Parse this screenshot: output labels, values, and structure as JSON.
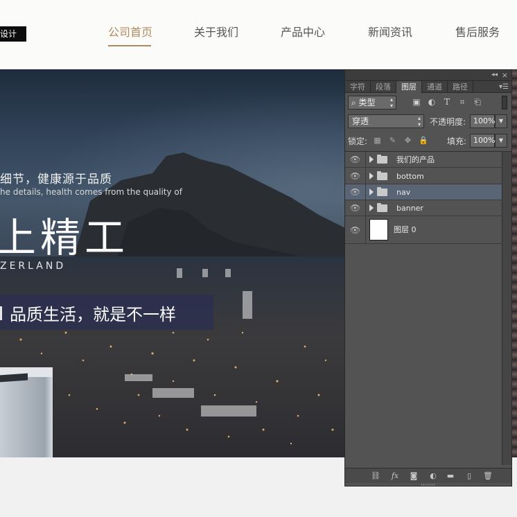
{
  "header": {
    "logo_text": "设计",
    "nav": [
      {
        "label": "公司首页",
        "active": true
      },
      {
        "label": "关于我们"
      },
      {
        "label": "产品中心"
      },
      {
        "label": "新闻资讯"
      },
      {
        "label": "售后服务"
      }
    ],
    "accent_color": "#b08a5c"
  },
  "banner": {
    "line1": "细节，健康源于品质",
    "line2": "he details, health comes from the quality of",
    "big_title": "上精工",
    "english": "ZERLAND",
    "slogan": "品质生活，就是不一样"
  },
  "ps_panel": {
    "tabs": [
      {
        "label": "字符"
      },
      {
        "label": "段落"
      },
      {
        "label": "图层",
        "active": true
      },
      {
        "label": "通道"
      },
      {
        "label": "路径"
      }
    ],
    "filter": {
      "label": "类型",
      "icons": [
        "image-filter-icon",
        "adjustment-filter-icon",
        "type-filter-icon",
        "shape-filter-icon",
        "smart-object-filter-icon"
      ]
    },
    "blend_mode": "穿透",
    "opacity_label": "不透明度:",
    "opacity_value": "100%",
    "lock_label": "锁定:",
    "fill_label": "填充:",
    "fill_value": "100%",
    "layers": [
      {
        "name": "我们的产品",
        "type": "group"
      },
      {
        "name": "bottom",
        "type": "group"
      },
      {
        "name": "nav",
        "type": "group",
        "selected": true
      },
      {
        "name": "banner",
        "type": "group"
      },
      {
        "name": "图层 0",
        "type": "layer"
      }
    ],
    "bottom_icons": [
      "link-layers-icon",
      "fx-icon",
      "add-mask-icon",
      "adjustment-layer-icon",
      "new-group-icon",
      "new-layer-icon",
      "trash-icon"
    ],
    "bottom_fx": "fx"
  }
}
